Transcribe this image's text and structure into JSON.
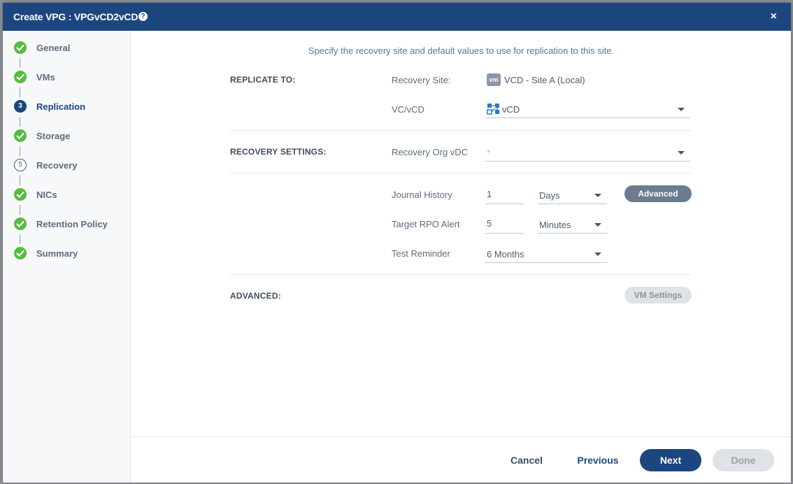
{
  "dialog": {
    "title": "Create VPG : VPGvCD2vCD",
    "help_icon": "question-circle-icon",
    "close_icon": "close-icon",
    "close_glyph": "×"
  },
  "steps": [
    {
      "number": "1",
      "label": "General",
      "status": "done"
    },
    {
      "number": "2",
      "label": "VMs",
      "status": "done"
    },
    {
      "number": "3",
      "label": "Replication",
      "status": "current"
    },
    {
      "number": "4",
      "label": "Storage",
      "status": "done"
    },
    {
      "number": "5",
      "label": "Recovery",
      "status": "pending"
    },
    {
      "number": "6",
      "label": "NICs",
      "status": "done"
    },
    {
      "number": "7",
      "label": "Retention Policy",
      "status": "done"
    },
    {
      "number": "8",
      "label": "Summary",
      "status": "done"
    }
  ],
  "intro": "Specify the recovery site and default values to use for replication to this site.",
  "replicate_to": {
    "section_label": "REPLICATE TO:",
    "recovery_site_label": "Recovery Site:",
    "recovery_site_badge": "vm",
    "recovery_site_value": "VCD - Site A (Local)",
    "vc_vcd_label": "VC/vCD",
    "vc_vcd_value": "vCD"
  },
  "recovery_settings": {
    "section_label": "RECOVERY SETTINGS:",
    "org_vdc_label": "Recovery Org vDC",
    "org_vdc_placeholder": "*"
  },
  "journal": {
    "journal_history_label": "Journal History",
    "journal_history_value": "1",
    "journal_history_unit": "Days",
    "advanced_button": "Advanced",
    "target_rpo_label": "Target RPO Alert",
    "target_rpo_value": "5",
    "target_rpo_unit": "Minutes",
    "test_reminder_label": "Test Reminder",
    "test_reminder_value": "6 Months"
  },
  "advanced": {
    "section_label": "ADVANCED:",
    "vm_settings_button": "VM Settings"
  },
  "footer": {
    "cancel": "Cancel",
    "previous": "Previous",
    "next": "Next",
    "done": "Done"
  },
  "colors": {
    "header": "#1c467e",
    "done_green": "#56bd3e",
    "primary_button": "#1c467e",
    "disabled_button": "#dfe2e6",
    "advanced_button": "#6a7c8d"
  }
}
